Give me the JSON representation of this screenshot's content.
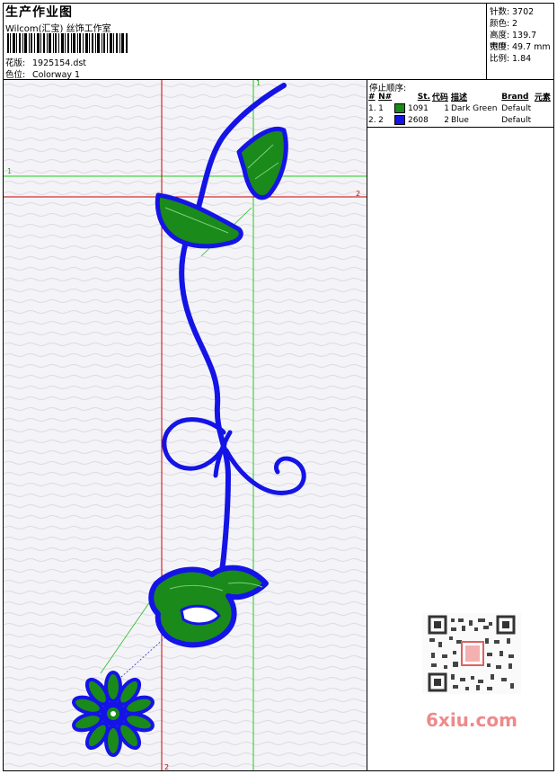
{
  "header": {
    "title": "生产作业图",
    "subtitle": "Wilcom(汇宝) 丝饰工作室",
    "design_label": "花版:",
    "design_value": "1925154.dst",
    "colorway_label": "色位:",
    "colorway_value": "Colorway 1"
  },
  "stats": [
    {
      "label": "针数:",
      "value": "3702"
    },
    {
      "label": "颜色:",
      "value": "2"
    },
    {
      "label": "高度:",
      "value": "139.7 mm"
    },
    {
      "label": "宽度:",
      "value": "49.7 mm"
    },
    {
      "label": "比例:",
      "value": "1.84"
    }
  ],
  "sequence": {
    "title": "停止顺序:",
    "headers": [
      "#",
      "N#",
      "St.",
      "代码",
      "描述",
      "Brand",
      "元素"
    ],
    "rows": [
      {
        "index": "1.",
        "n": "1",
        "color": "#1a8a1a",
        "stitches": "1091",
        "code": "1",
        "desc": "Dark Green",
        "brand": "Default"
      },
      {
        "index": "2.",
        "n": "2",
        "color": "#1414e6",
        "stitches": "2608",
        "code": "2",
        "desc": "Blue",
        "brand": "Default"
      }
    ]
  },
  "guides": {
    "green_v": "1",
    "green_h": "1",
    "red_h": "2",
    "red_v": "2"
  },
  "watermark": "6xiu.com",
  "colors": {
    "green": "#1a8a1a",
    "blue": "#1414e6",
    "guide_red": "#cc0000",
    "guide_green": "#00cc00"
  }
}
